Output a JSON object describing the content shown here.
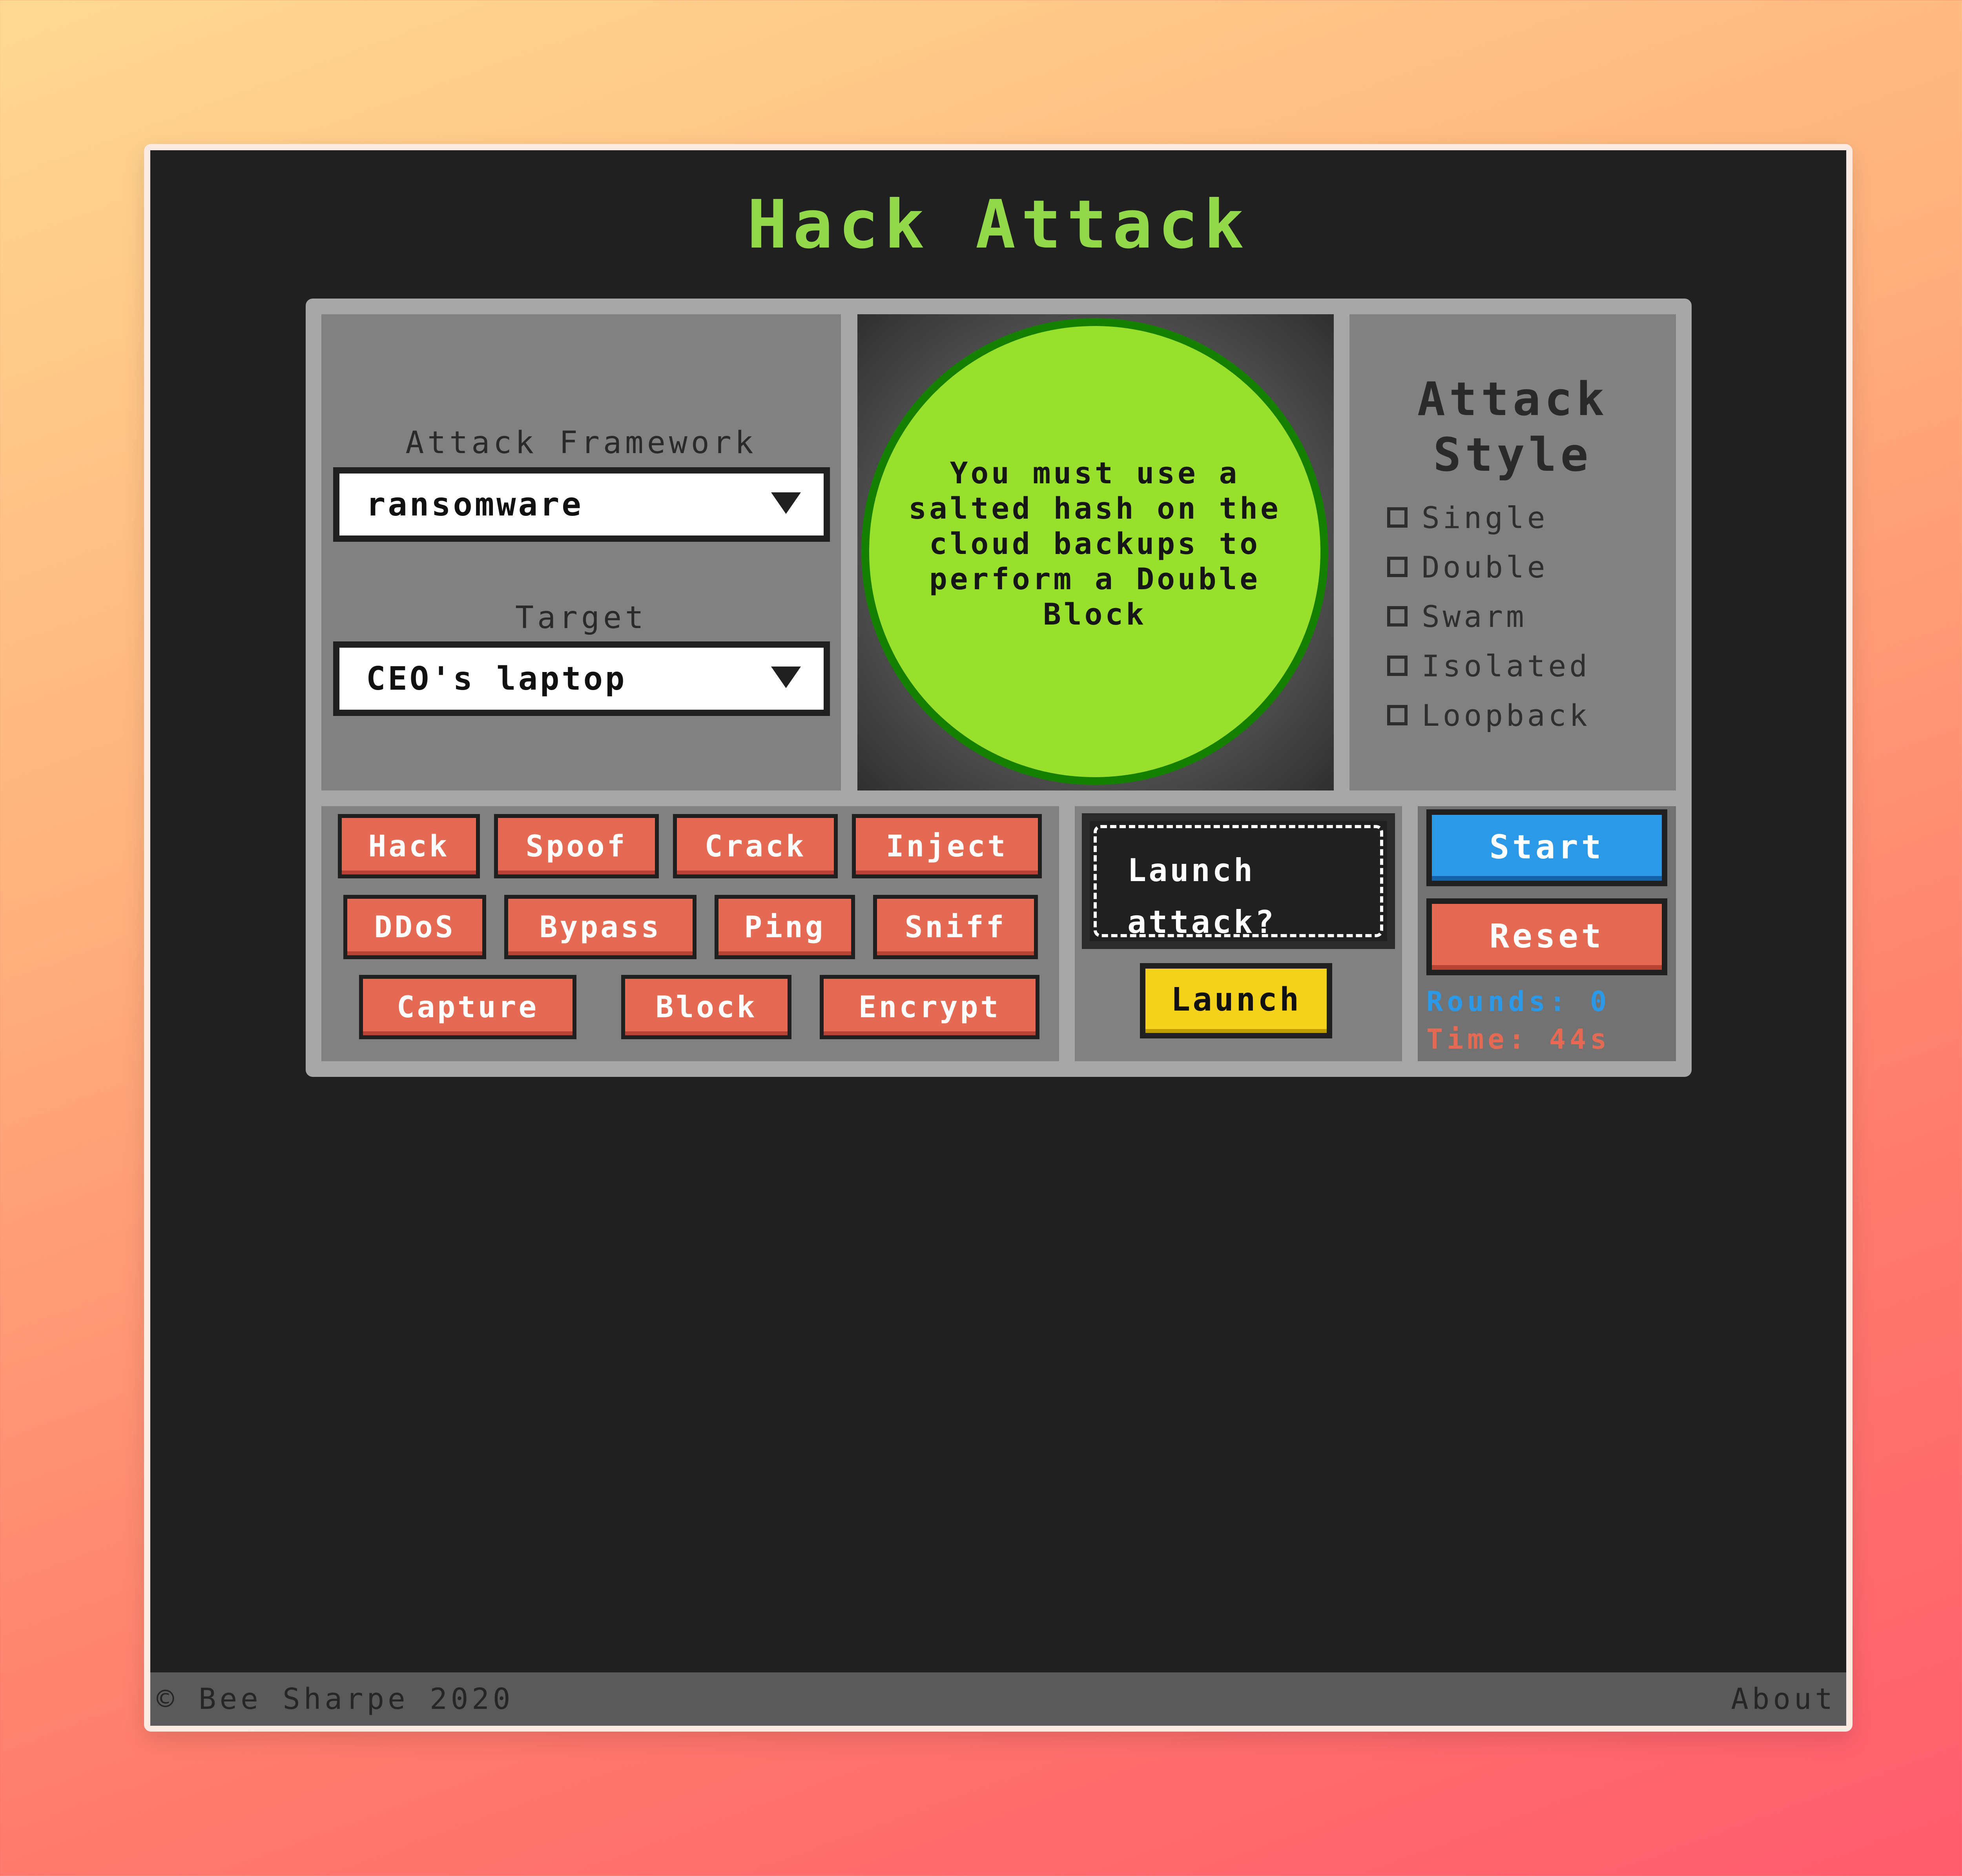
{
  "app": {
    "title": "Hack Attack"
  },
  "controls": {
    "framework_label": "Attack Framework",
    "framework_value": "ransomware",
    "target_label": "Target",
    "target_value": "CEO's laptop"
  },
  "message": {
    "text": "You must use a salted hash on the cloud backups to perform a Double Block"
  },
  "attack_style": {
    "title": "Attack Style",
    "options": [
      {
        "label": "Single",
        "checked": false
      },
      {
        "label": "Double",
        "checked": false
      },
      {
        "label": "Swarm",
        "checked": false
      },
      {
        "label": "Isolated",
        "checked": false
      },
      {
        "label": "Loopback",
        "checked": false
      }
    ]
  },
  "actions": [
    "Hack",
    "Spoof",
    "Crack",
    "Inject",
    "DDoS",
    "Bypass",
    "Ping",
    "Sniff",
    "Capture",
    "Block",
    "Encrypt"
  ],
  "launch": {
    "prompt": "Launch attack?",
    "button": "Launch"
  },
  "game": {
    "start": "Start",
    "reset": "Reset",
    "rounds_label": "Rounds:",
    "rounds_value": "0",
    "time_label": "Time:",
    "time_value": "44s"
  },
  "footer": {
    "left": "© Bee Sharpe 2020",
    "right": "About"
  },
  "colors": {
    "title": "#93d84b",
    "board": "#a7a7a7",
    "panel": "#818181",
    "action": "#e56a54",
    "launch": "#f4d11b",
    "start": "#2c98e8",
    "circle": "#98e02b",
    "circle_border": "#158000"
  }
}
